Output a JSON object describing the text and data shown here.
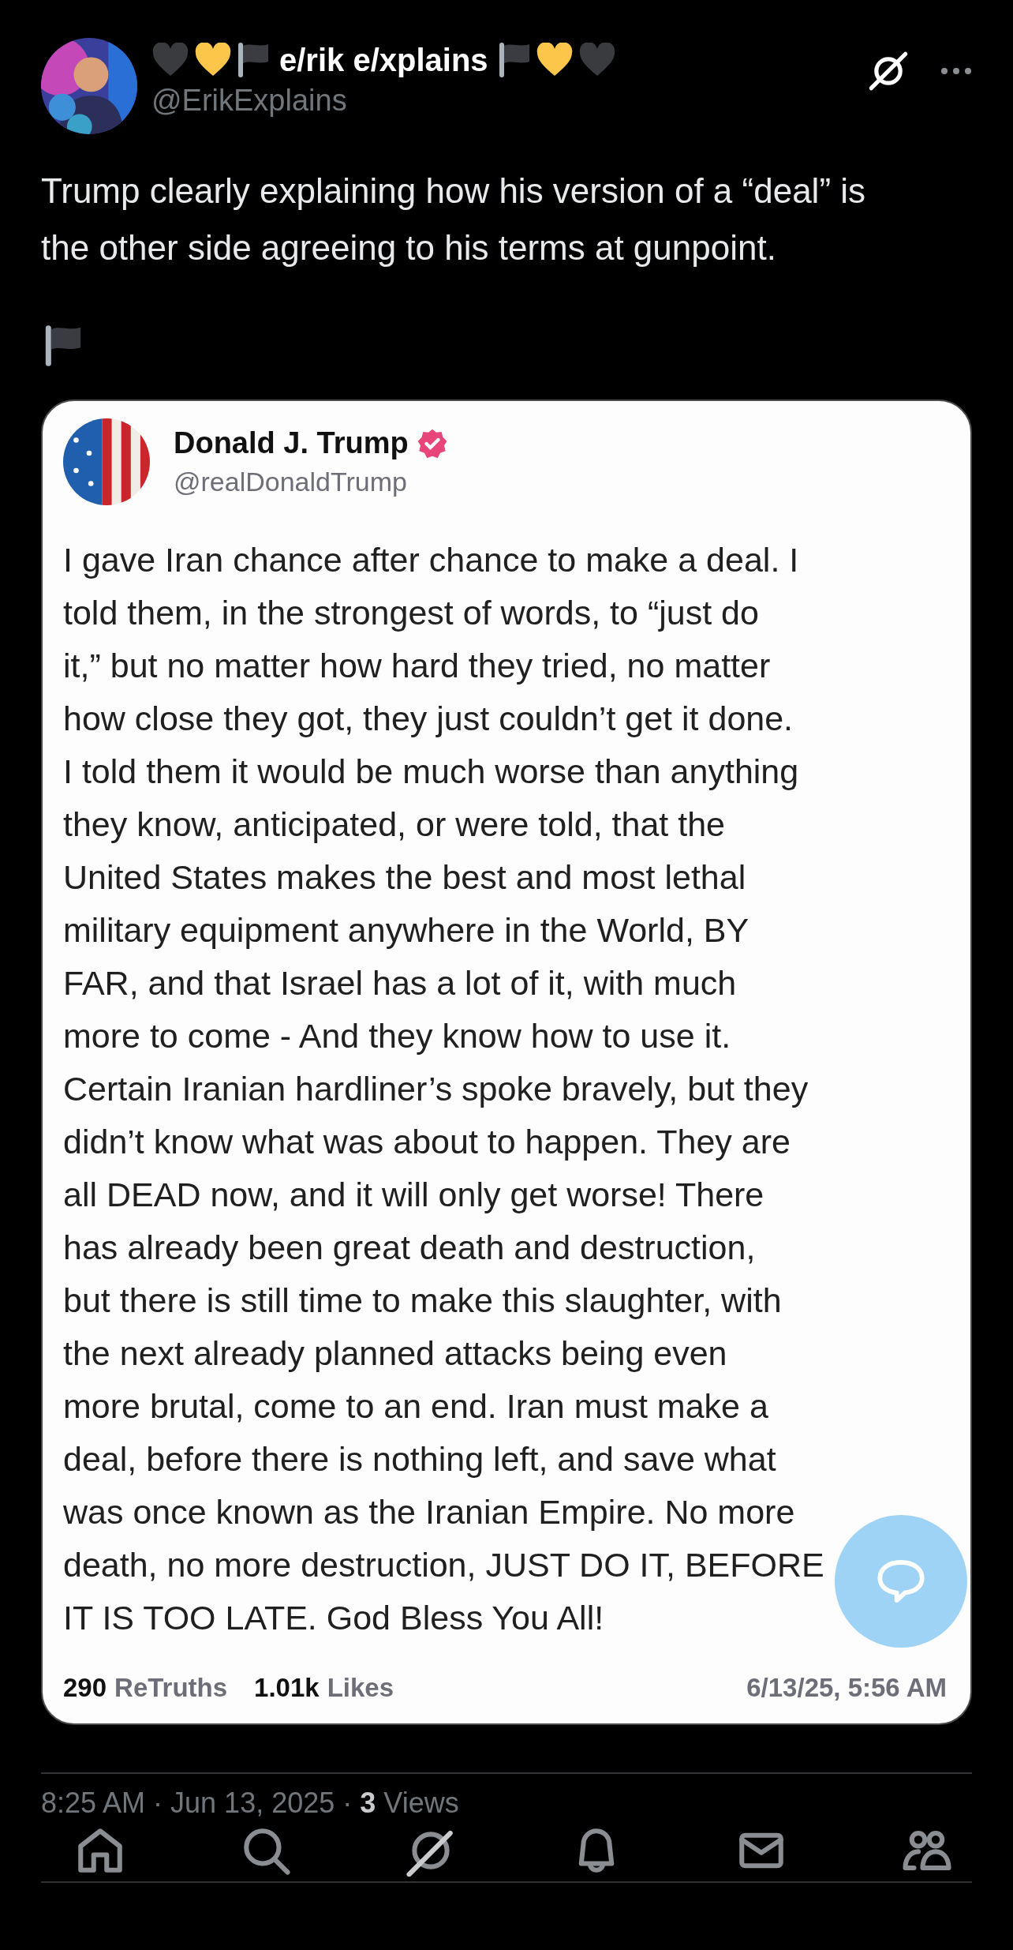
{
  "author": {
    "name": "e/rik e/xplains",
    "handle": "@ErikExplains"
  },
  "post": {
    "text": "Trump clearly explaining how his version of a “deal” is the other side agreeing to his terms at gunpoint."
  },
  "quoted": {
    "name": "Donald J. Trump",
    "verified": true,
    "handle": "@realDonaldTrump",
    "body_lines": [
      "I gave Iran chance after chance to make a deal. I",
      "told them, in the strongest of words, to “just do",
      "it,” but no matter how hard they tried, no matter",
      "how close they got, they just couldn’t get it done.",
      "I told them it would be much worse than anything",
      "they know, anticipated, or were told, that the",
      "United States makes the best and most lethal",
      "military equipment anywhere in the World, BY",
      "FAR, and that Israel has a lot of it, with much",
      "more to come - And they know how to use it.",
      "Certain Iranian hardliner’s spoke bravely, but they",
      "didn’t know what was about to happen. They are",
      "all DEAD now, and it will only get worse! There",
      "has already been great death and destruction,",
      "but there is still time to make this slaughter, with",
      "the next already planned attacks being even",
      "more brutal, come to an end. Iran must make a",
      "deal, before there is nothing left, and save what",
      "was once known as the Iranian Empire. No more",
      "death, no more destruction, JUST DO IT, BEFORE",
      "IT IS TOO LATE. God Bless You All!"
    ],
    "retruths_count": "290",
    "retruths_label": "ReTruths",
    "likes_count": "1.01k",
    "likes_label": "Likes",
    "time": "6/13/25, 5:56 AM"
  },
  "meta": {
    "text": "8:25 AM · Jun 13, 2025 · **3** Views"
  },
  "nav": [
    {
      "kind": "home"
    },
    {
      "kind": "search"
    },
    {
      "kind": "grok"
    },
    {
      "kind": "bell"
    },
    {
      "kind": "mail"
    },
    {
      "kind": "people"
    }
  ]
}
